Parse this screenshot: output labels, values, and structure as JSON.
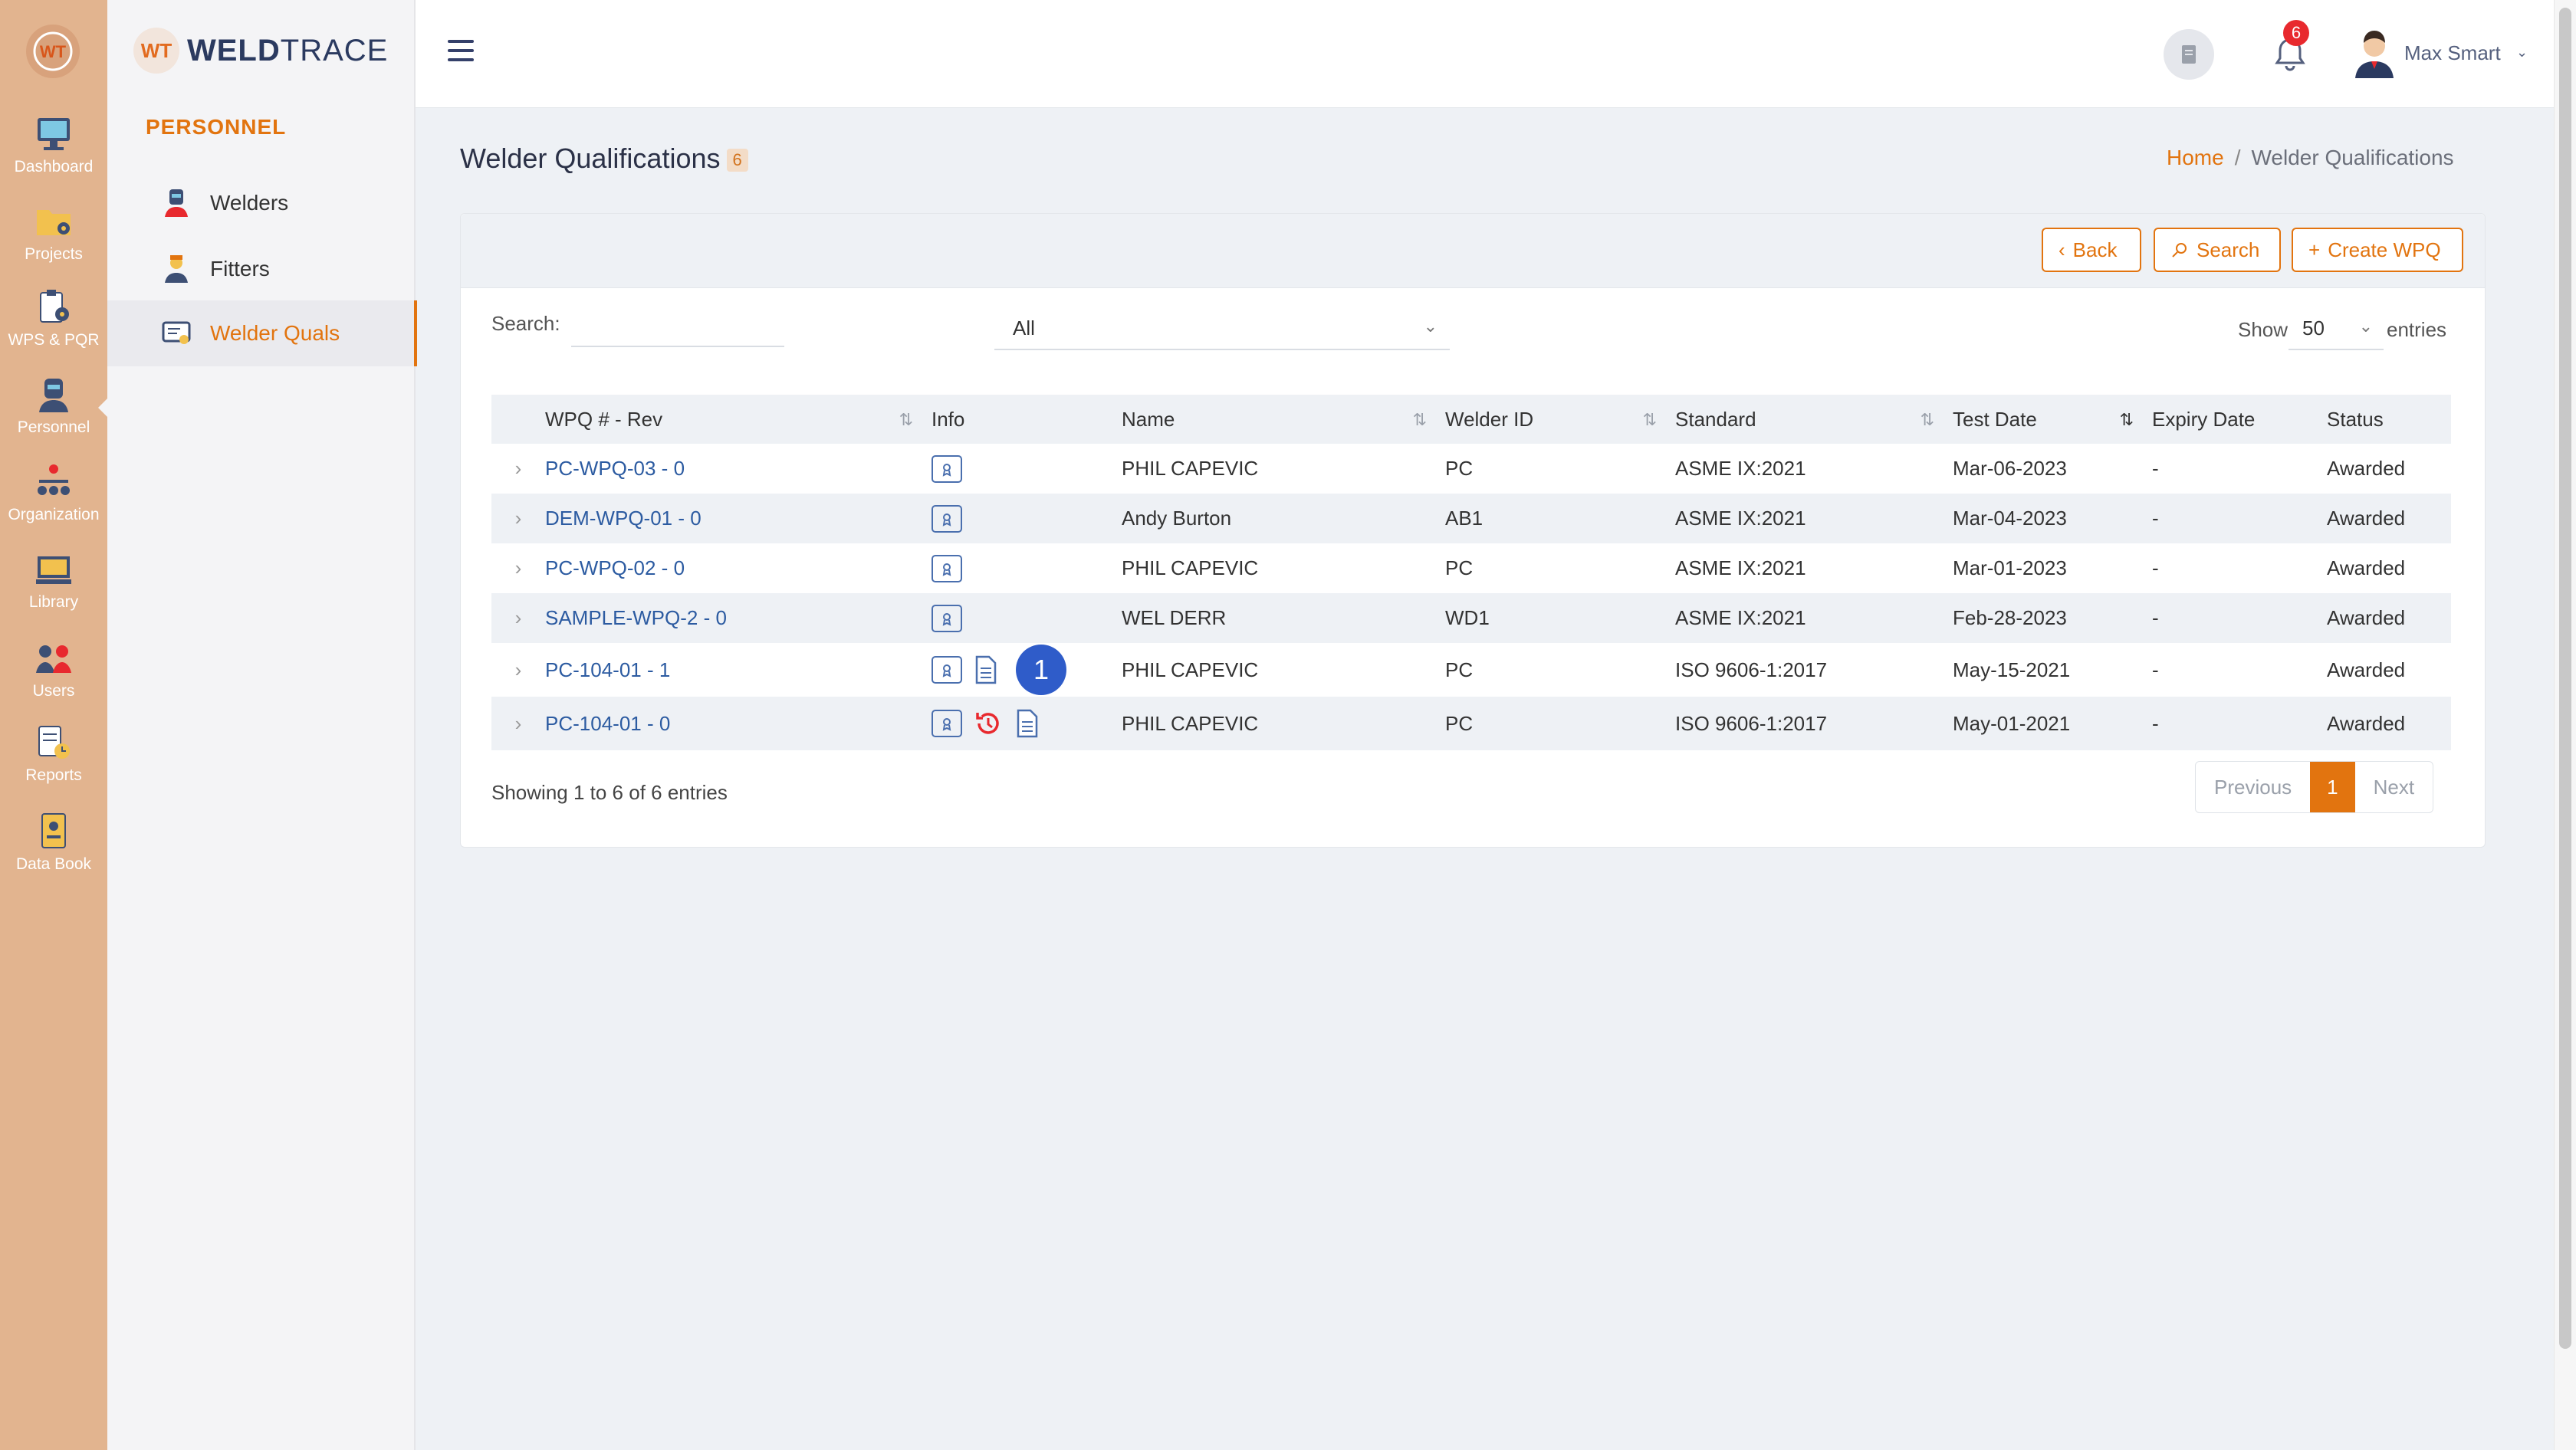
{
  "brand": {
    "bold": "WELD",
    "light": "TRACE",
    "logo_text": "WT"
  },
  "rail": [
    {
      "label": "Dashboard",
      "icon": "monitor-icon"
    },
    {
      "label": "Projects",
      "icon": "folder-gear-icon"
    },
    {
      "label": "WPS & PQR",
      "icon": "clipboard-gear-icon"
    },
    {
      "label": "Personnel",
      "icon": "welder-icon",
      "active": true
    },
    {
      "label": "Organization",
      "icon": "org-chart-icon"
    },
    {
      "label": "Library",
      "icon": "library-icon"
    },
    {
      "label": "Users",
      "icon": "users-icon"
    },
    {
      "label": "Reports",
      "icon": "report-clock-icon"
    },
    {
      "label": "Data Book",
      "icon": "data-book-icon"
    }
  ],
  "sidebar": {
    "section": "PERSONNEL",
    "items": [
      {
        "label": "Welders",
        "icon": "welder-icon"
      },
      {
        "label": "Fitters",
        "icon": "fitter-icon"
      },
      {
        "label": "Welder Quals",
        "icon": "certificate-icon",
        "active": true
      }
    ]
  },
  "topbar": {
    "notifications": "6",
    "user": "Max Smart"
  },
  "page": {
    "title": "Welder Qualifications",
    "count": "6"
  },
  "breadcrumb": {
    "home": "Home",
    "sep": "/",
    "current": "Welder Qualifications"
  },
  "actions": {
    "back": "Back",
    "search": "Search",
    "create": "Create WPQ"
  },
  "filters": {
    "search_label": "Search:",
    "search_value": "",
    "type_value": "All",
    "show_label": "Show",
    "show_value": "50",
    "entries_label": "entries"
  },
  "table": {
    "columns": [
      "WPQ # - Rev",
      "Info",
      "Name",
      "Welder ID",
      "Standard",
      "Test Date",
      "Expiry Date",
      "Status"
    ],
    "rows": [
      {
        "wpq": "PC-WPQ-03 - 0",
        "name": "PHIL CAPEVIC",
        "welder_id": "PC",
        "standard": "ASME IX:2021",
        "test_date": "Mar-06-2023",
        "expiry": "-",
        "status": "Awarded"
      },
      {
        "wpq": "DEM-WPQ-01 - 0",
        "name": "Andy Burton",
        "welder_id": "AB1",
        "standard": "ASME IX:2021",
        "test_date": "Mar-04-2023",
        "expiry": "-",
        "status": "Awarded"
      },
      {
        "wpq": "PC-WPQ-02 - 0",
        "name": "PHIL CAPEVIC",
        "welder_id": "PC",
        "standard": "ASME IX:2021",
        "test_date": "Mar-01-2023",
        "expiry": "-",
        "status": "Awarded"
      },
      {
        "wpq": "SAMPLE-WPQ-2 - 0",
        "name": "WEL DERR",
        "welder_id": "WD1",
        "standard": "ASME IX:2021",
        "test_date": "Feb-28-2023",
        "expiry": "-",
        "status": "Awarded"
      },
      {
        "wpq": "PC-104-01 - 1",
        "name": "PHIL CAPEVIC",
        "welder_id": "PC",
        "standard": "ISO 9606-1:2017",
        "test_date": "May-15-2021",
        "expiry": "-",
        "status": "Awarded",
        "step_marker": "1"
      },
      {
        "wpq": "PC-104-01 - 0",
        "name": "PHIL CAPEVIC",
        "welder_id": "PC",
        "standard": "ISO 9606-1:2017",
        "test_date": "May-01-2021",
        "expiry": "-",
        "status": "Awarded"
      }
    ]
  },
  "footer": {
    "info": "Showing 1 to 6 of 6 entries",
    "previous": "Previous",
    "current_page": "1",
    "next": "Next"
  },
  "colors": {
    "accent": "#e2740f",
    "rail": "#e2b48f",
    "link": "#2c5ba1",
    "badge": "#e8292e",
    "marker": "#2f5cc9"
  }
}
